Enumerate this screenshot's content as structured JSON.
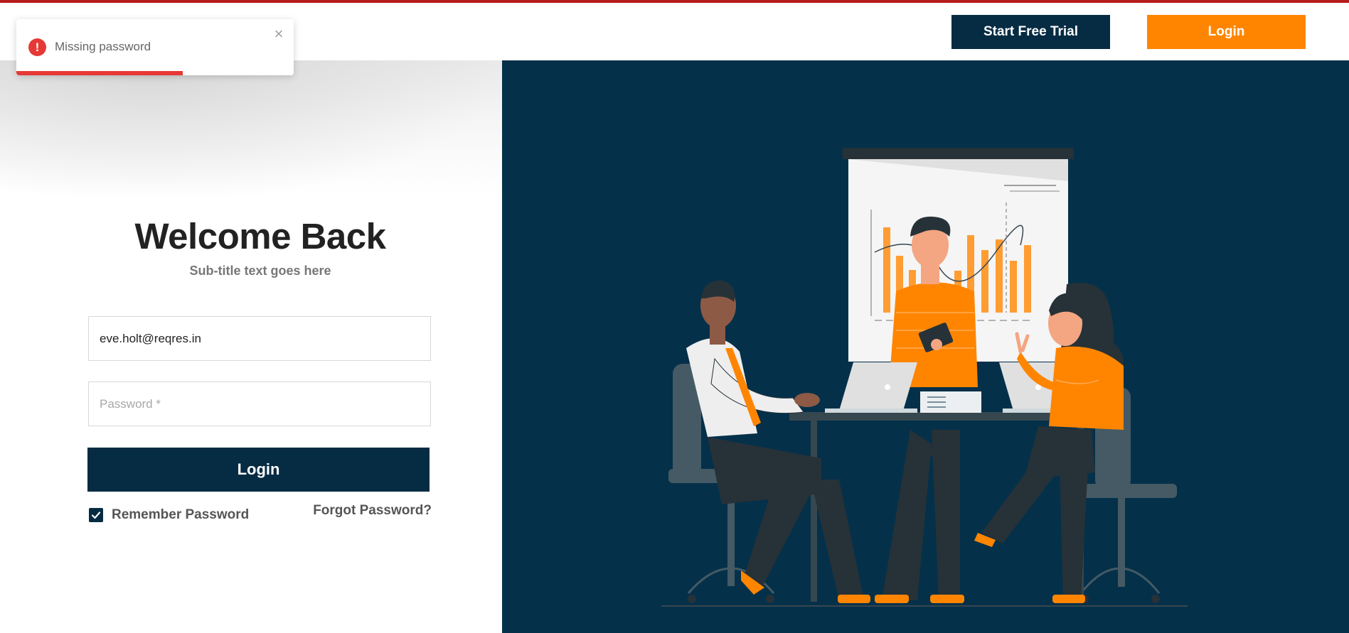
{
  "header": {
    "trial_label": "Start Free Trial",
    "login_label": "Login"
  },
  "toast": {
    "message": "Missing password",
    "close_symbol": "×",
    "icon_symbol": "!",
    "progress_fraction": 0.6
  },
  "login_form": {
    "title": "Welcome Back",
    "subtitle": "Sub-title text goes here",
    "email_value": "eve.holt@reqres.in",
    "password_placeholder": "Password *",
    "submit_label": "Login",
    "remember_label": "Remember Password",
    "remember_checked": true,
    "forgot_label": "Forgot Password?"
  },
  "colors": {
    "navy": "#062c43",
    "orange": "#ff8500",
    "error_red": "#e53935"
  },
  "illustration": {
    "icon": "team-meeting-illustration"
  }
}
